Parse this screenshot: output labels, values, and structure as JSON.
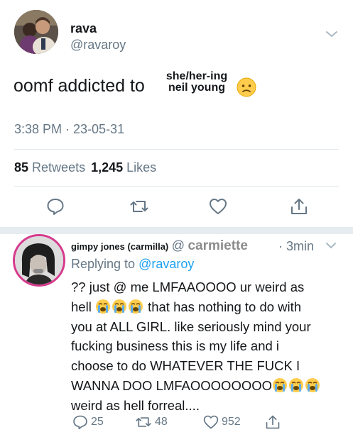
{
  "tweet": {
    "display_name": "rava",
    "handle": "@ravaroy",
    "text_main": "oomf addicted to",
    "stack_top": "she/her-ing",
    "stack_bottom": "neil young",
    "emoji": "worried-face-emoji",
    "timestamp": "3:38 PM · 23-05-31",
    "retweets_count": "85",
    "retweets_label": "Retweets",
    "likes_count": "1,245",
    "likes_label": "Likes"
  },
  "reply": {
    "display_name": "gimpy jones (carmilla)",
    "at": "@",
    "handle": "carmiette",
    "time": "· 3min",
    "replying_prefix": "Replying to",
    "replying_to": "@ravaroy",
    "line1": "?? just @ me LMFAAOOOO ur weird as",
    "line2_pre": "hell",
    "line2_post": "that has nothing to do with",
    "line3": "you at ALL GIRL. like seriously mind your",
    "line4": "fucking business this is my life and i",
    "line5": "choose to do WHATEVER THE FUCK I",
    "line6": "WANNA DOO LMFAOOOOOOOO",
    "line7": "weird as hell forreal....",
    "reply_count": "25",
    "retweet_count": "48",
    "like_count": "952"
  },
  "colors": {
    "primary_text": "#14171a",
    "secondary_text": "#657786",
    "link": "#1da1f2",
    "avatar_ring": "#d63a8d"
  }
}
